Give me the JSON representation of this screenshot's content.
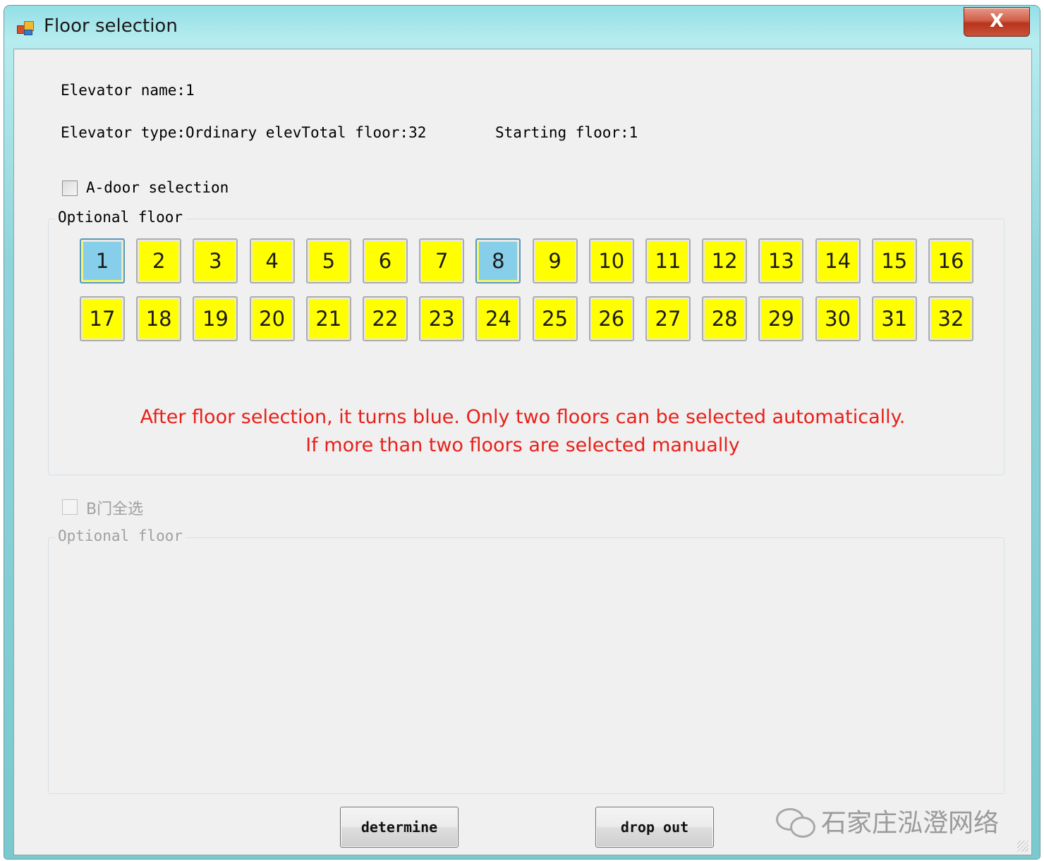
{
  "window": {
    "title": "Floor selection",
    "close_label": "X"
  },
  "info": {
    "elevator_name": "Elevator name:1",
    "elevator_type": "Elevator type:Ordinary elevTotal floor:32",
    "starting_floor": "Starting floor:1"
  },
  "door_a": {
    "select_all_label": "A-door selection",
    "select_all_checked": false,
    "group_title": "Optional floor",
    "floors": [
      {
        "label": "1",
        "selected": true
      },
      {
        "label": "2",
        "selected": false
      },
      {
        "label": "3",
        "selected": false
      },
      {
        "label": "4",
        "selected": false
      },
      {
        "label": "5",
        "selected": false
      },
      {
        "label": "6",
        "selected": false
      },
      {
        "label": "7",
        "selected": false
      },
      {
        "label": "8",
        "selected": true
      },
      {
        "label": "9",
        "selected": false
      },
      {
        "label": "10",
        "selected": false
      },
      {
        "label": "11",
        "selected": false
      },
      {
        "label": "12",
        "selected": false
      },
      {
        "label": "13",
        "selected": false
      },
      {
        "label": "14",
        "selected": false
      },
      {
        "label": "15",
        "selected": false
      },
      {
        "label": "16",
        "selected": false
      },
      {
        "label": "17",
        "selected": false
      },
      {
        "label": "18",
        "selected": false
      },
      {
        "label": "19",
        "selected": false
      },
      {
        "label": "20",
        "selected": false
      },
      {
        "label": "21",
        "selected": false
      },
      {
        "label": "22",
        "selected": false
      },
      {
        "label": "23",
        "selected": false
      },
      {
        "label": "24",
        "selected": false
      },
      {
        "label": "25",
        "selected": false
      },
      {
        "label": "26",
        "selected": false
      },
      {
        "label": "27",
        "selected": false
      },
      {
        "label": "28",
        "selected": false
      },
      {
        "label": "29",
        "selected": false
      },
      {
        "label": "30",
        "selected": false
      },
      {
        "label": "31",
        "selected": false
      },
      {
        "label": "32",
        "selected": false
      }
    ],
    "note_line1": "After floor selection, it turns blue. Only two floors can be selected automatically.",
    "note_line2": "If more than two floors are selected manually"
  },
  "door_b": {
    "select_all_label": "B门全选",
    "select_all_checked": false,
    "enabled": false,
    "group_title": "Optional floor"
  },
  "buttons": {
    "determine": "determine",
    "drop_out": "drop out"
  },
  "watermark": "石家庄泓澄网络",
  "colors": {
    "floor_default": "#ffff00",
    "floor_selected": "#87ceeb",
    "note_text": "#e8201a",
    "disabled_text": "#a0a0a0"
  }
}
